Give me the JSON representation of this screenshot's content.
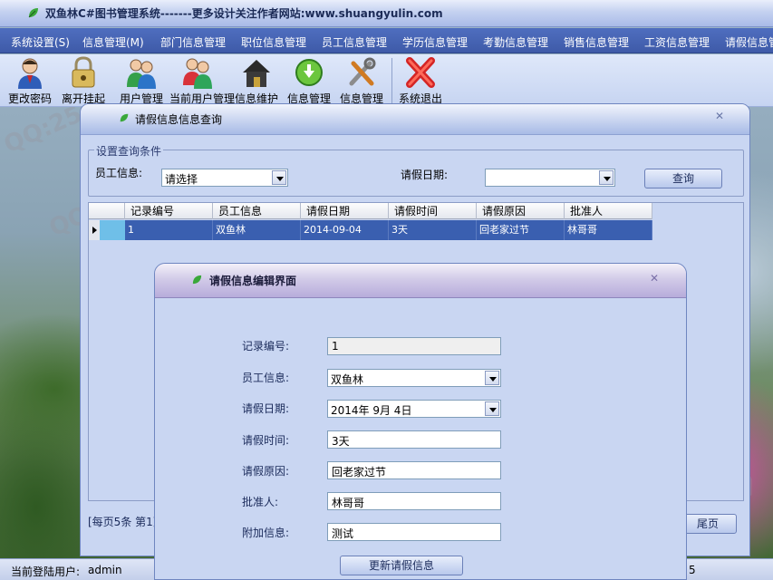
{
  "app": {
    "title": "双鱼林C#图书管理系统-------更多设计关注作者网站:www.shuangyulin.com"
  },
  "menu": [
    "系统设置(S)",
    "信息管理(M)",
    "部门信息管理",
    "职位信息管理",
    "员工信息管理",
    "学历信息管理",
    "考勤信息管理",
    "销售信息管理",
    "工资信息管理",
    "请假信息管"
  ],
  "toolbar": [
    {
      "label": "更改密码",
      "icon": "user-key-icon"
    },
    {
      "label": "离开挂起",
      "icon": "lock-icon"
    },
    {
      "label": "用户管理",
      "icon": "users-icon"
    },
    {
      "label": "当前用户管理",
      "icon": "user-pair-icon"
    },
    {
      "label": "信息维护",
      "icon": "home-icon"
    },
    {
      "label": "信息管理",
      "icon": "green-arrow-icon"
    },
    {
      "label": "信息管理",
      "icon": "tools-icon"
    },
    {
      "label": "系统退出",
      "icon": "exit-x-icon"
    }
  ],
  "query_window": {
    "title": "请假信息信息查询",
    "group_title": "设置查询条件",
    "employee_label": "员工信息:",
    "employee_value": "请选择",
    "date_label": "请假日期:",
    "date_value": "",
    "query_button": "查询",
    "columns": [
      "记录编号",
      "员工信息",
      "请假日期",
      "请假时间",
      "请假原因",
      "批准人"
    ],
    "rows": [
      [
        "1",
        "双鱼林",
        "2014-09-04",
        "3天",
        "回老家过节",
        "林哥哥"
      ]
    ],
    "pager_text": "[每页5条  第1页",
    "last_page_button": "尾页"
  },
  "edit_dialog": {
    "title": "请假信息编辑界面",
    "fields": [
      {
        "label": "记录编号:",
        "value": "1"
      },
      {
        "label": "员工信息:",
        "value": "双鱼林"
      },
      {
        "label": "请假日期:",
        "value": "2014年  9月  4日"
      },
      {
        "label": "请假时间:",
        "value": "3天"
      },
      {
        "label": "请假原因:",
        "value": "回老家过节"
      },
      {
        "label": "批准人:",
        "value": "林哥哥"
      },
      {
        "label": "附加信息:",
        "value": "测试"
      }
    ],
    "update_button": "更新请假信息"
  },
  "status": {
    "user_label": "当前登陆用户:",
    "user_value": "admin",
    "right_fragment": "5"
  },
  "watermarks": [
    "QQ:254540457",
    "双鱼林源码出品",
    "汪建林程序设计"
  ]
}
